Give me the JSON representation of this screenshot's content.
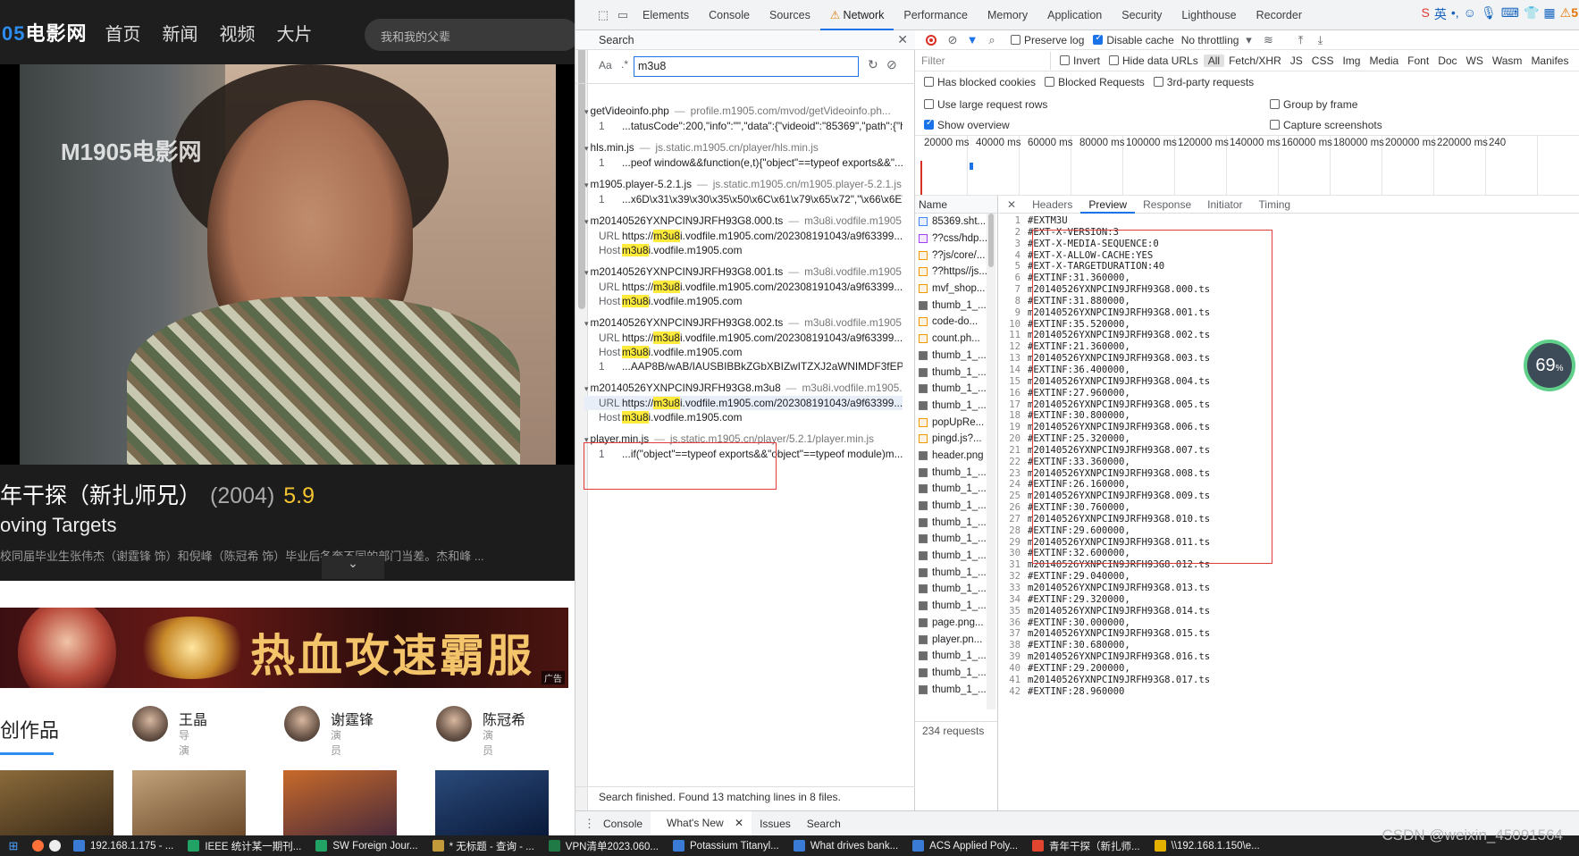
{
  "site": {
    "logo_num": "05",
    "logo_text": "电影网",
    "nav": [
      "首页",
      "新闻",
      "视频",
      "大片"
    ],
    "search_placeholder": "我和我的父辈",
    "watermark": "M1905电影网",
    "film_title": "年干探（新扎师兄）",
    "film_year": "(2004)",
    "film_score": "5.9",
    "film_en": "oving Targets",
    "film_desc": "校同届毕业生张伟杰（谢霆锋 饰）和倪峰（陈冠希 饰）毕业后各奔不同的部门当差。杰和峰 ...",
    "ad_text": "热血攻速霸服",
    "ad_tag": "广告",
    "cast_heading": "创作品",
    "cast": [
      {
        "name": "王晶",
        "role": "导演"
      },
      {
        "name": "谢霆锋",
        "role": "演员"
      },
      {
        "name": "陈冠希",
        "role": "演员"
      }
    ]
  },
  "devtools": {
    "tabs": [
      "Elements",
      "Console",
      "Sources",
      "Network",
      "Performance",
      "Memory",
      "Application",
      "Security",
      "Lighthouse",
      "Recorder"
    ],
    "active_tab": "Network",
    "warning_count": "5",
    "search": {
      "title": "Search",
      "query": "m3u8",
      "status": "Search finished.  Found 13 matching lines in 8 files.",
      "results": [
        {
          "file": "getVideoinfo.php",
          "url": "profile.m1905.com/mvod/getVideoinfo.ph...",
          "lines": [
            {
              "k": "1",
              "text": "...tatusCode\":200,\"info\":\"\",\"data\":{\"videoid\":\"85369\",\"path\":{\"h..."
            }
          ]
        },
        {
          "file": "hls.min.js",
          "url": "js.static.m1905.cn/player/hls.min.js",
          "lines": [
            {
              "k": "1",
              "text": "...peof window&&function(e,t){\"object\"==typeof exports&&\"..."
            }
          ]
        },
        {
          "file": "m1905.player-5.2.1.js",
          "url": "js.static.m1905.cn/m1905.player-5.2.1.js",
          "lines": [
            {
              "k": "1",
              "text": "...x6D\\x31\\x39\\x30\\x35\\x50\\x6C\\x61\\x79\\x65\\x72\",\"\\x66\\x6E\"..."
            }
          ]
        },
        {
          "file": "m20140526YXNPCIN9JRFH93G8.000.ts",
          "url": "m3u8i.vodfile.m1905....",
          "lines": [
            {
              "k": "URL",
              "pre": "https://",
              "hl": "m3u8",
              "text": "i.vodfile.m1905.com/202308191043/a9f63399..."
            },
            {
              "k": "Host",
              "pre": "",
              "hl": "m3u8",
              "text": "i.vodfile.m1905.com"
            }
          ]
        },
        {
          "file": "m20140526YXNPCIN9JRFH93G8.001.ts",
          "url": "m3u8i.vodfile.m1905....",
          "lines": [
            {
              "k": "URL",
              "pre": "https://",
              "hl": "m3u8",
              "text": "i.vodfile.m1905.com/202308191043/a9f63399..."
            },
            {
              "k": "Host",
              "pre": "",
              "hl": "m3u8",
              "text": "i.vodfile.m1905.com"
            }
          ]
        },
        {
          "file": "m20140526YXNPCIN9JRFH93G8.002.ts",
          "url": "m3u8i.vodfile.m1905....",
          "lines": [
            {
              "k": "URL",
              "pre": "https://",
              "hl": "m3u8",
              "text": "i.vodfile.m1905.com/202308191043/a9f63399..."
            },
            {
              "k": "Host",
              "pre": "",
              "hl": "m3u8",
              "text": "i.vodfile.m1905.com"
            },
            {
              "k": "1",
              "text": "...AAP8B/wAB/IAUSBIBBkZGbXBIZwITZXJ2aWNIMDF3fEPK////..."
            }
          ]
        },
        {
          "file": "m20140526YXNPCIN9JRFH93G8.m3u8",
          "url": "m3u8i.vodfile.m1905....",
          "lines": [
            {
              "k": "URL",
              "pre": "https://",
              "hl": "m3u8",
              "text": "i.vodfile.m1905.com/202308191043/a9f63399..."
            },
            {
              "k": "Host",
              "pre": "",
              "hl": "m3u8",
              "text": "i.vodfile.m1905.com"
            }
          ]
        },
        {
          "file": "player.min.js",
          "url": "js.static.m1905.cn/player/5.2.1/player.min.js",
          "lines": [
            {
              "k": "1",
              "text": "...if(\"object\"==typeof exports&&\"object\"==typeof module)m..."
            }
          ]
        }
      ]
    },
    "network": {
      "toolbar": {
        "preserve_log": "Preserve log",
        "disable_cache": "Disable cache",
        "throttling": "No throttling"
      },
      "filter_placeholder": "Filter",
      "invert": "Invert",
      "hide_data_urls": "Hide data URLs",
      "types": [
        "All",
        "Fetch/XHR",
        "JS",
        "CSS",
        "Img",
        "Media",
        "Font",
        "Doc",
        "WS",
        "Wasm",
        "Manifes"
      ],
      "blocked_cookies": "Has blocked cookies",
      "blocked_requests": "Blocked Requests",
      "third_party": "3rd-party requests",
      "large_rows": "Use large request rows",
      "group_by_frame": "Group by frame",
      "show_overview": "Show overview",
      "capture_screenshots": "Capture screenshots",
      "timeline": [
        "20000 ms",
        "40000 ms",
        "60000 ms",
        "80000 ms",
        "100000 ms",
        "120000 ms",
        "140000 ms",
        "160000 ms",
        "180000 ms",
        "200000 ms",
        "220000 ms",
        "240"
      ],
      "name_header": "Name",
      "requests": [
        {
          "name": "85369.sht...",
          "type": "doc"
        },
        {
          "name": "??css/hdp...",
          "type": "css"
        },
        {
          "name": "??js/core/...",
          "type": "js"
        },
        {
          "name": "??https//js...",
          "type": "js"
        },
        {
          "name": "mvf_shop...",
          "type": "js"
        },
        {
          "name": "thumb_1_...",
          "type": "img"
        },
        {
          "name": "code-do...",
          "type": "js"
        },
        {
          "name": "count.ph...",
          "type": "js"
        },
        {
          "name": "thumb_1_...",
          "type": "img"
        },
        {
          "name": "thumb_1_...",
          "type": "img"
        },
        {
          "name": "thumb_1_...",
          "type": "img"
        },
        {
          "name": "thumb_1_...",
          "type": "img"
        },
        {
          "name": "popUpRe...",
          "type": "js"
        },
        {
          "name": "pingd.js?...",
          "type": "js"
        },
        {
          "name": "header.png",
          "type": "img"
        },
        {
          "name": "thumb_1_...",
          "type": "img"
        },
        {
          "name": "thumb_1_...",
          "type": "img"
        },
        {
          "name": "thumb_1_...",
          "type": "img"
        },
        {
          "name": "thumb_1_...",
          "type": "img"
        },
        {
          "name": "thumb_1_...",
          "type": "img"
        },
        {
          "name": "thumb_1_...",
          "type": "img"
        },
        {
          "name": "thumb_1_...",
          "type": "img"
        },
        {
          "name": "thumb_1_...",
          "type": "img"
        },
        {
          "name": "thumb_1_...",
          "type": "img"
        },
        {
          "name": "page.png...",
          "type": "img"
        },
        {
          "name": "player.pn...",
          "type": "img"
        },
        {
          "name": "thumb_1_...",
          "type": "img"
        },
        {
          "name": "thumb_1_...",
          "type": "img"
        },
        {
          "name": "thumb_1_...",
          "type": "img"
        }
      ],
      "request_count": "234 requests",
      "detail_tabs": [
        "Headers",
        "Preview",
        "Response",
        "Initiator",
        "Timing"
      ],
      "active_detail_tab": "Preview",
      "preview_lines": [
        "#EXTM3U",
        "#EXT-X-VERSION:3",
        "#EXT-X-MEDIA-SEQUENCE:0",
        "#EXT-X-ALLOW-CACHE:YES",
        "#EXT-X-TARGETDURATION:40",
        "#EXTINF:31.360000,",
        "m20140526YXNPCIN9JRFH93G8.000.ts",
        "#EXTINF:31.880000,",
        "m20140526YXNPCIN9JRFH93G8.001.ts",
        "#EXTINF:35.520000,",
        "m20140526YXNPCIN9JRFH93G8.002.ts",
        "#EXTINF:21.360000,",
        "m20140526YXNPCIN9JRFH93G8.003.ts",
        "#EXTINF:36.400000,",
        "m20140526YXNPCIN9JRFH93G8.004.ts",
        "#EXTINF:27.960000,",
        "m20140526YXNPCIN9JRFH93G8.005.ts",
        "#EXTINF:30.800000,",
        "m20140526YXNPCIN9JRFH93G8.006.ts",
        "#EXTINF:25.320000,",
        "m20140526YXNPCIN9JRFH93G8.007.ts",
        "#EXTINF:33.360000,",
        "m20140526YXNPCIN9JRFH93G8.008.ts",
        "#EXTINF:26.160000,",
        "m20140526YXNPCIN9JRFH93G8.009.ts",
        "#EXTINF:30.760000,",
        "m20140526YXNPCIN9JRFH93G8.010.ts",
        "#EXTINF:29.600000,",
        "m20140526YXNPCIN9JRFH93G8.011.ts",
        "#EXTINF:32.600000,",
        "m20140526YXNPCIN9JRFH93G8.012.ts",
        "#EXTINF:29.040000,",
        "m20140526YXNPCIN9JRFH93G8.013.ts",
        "#EXTINF:29.320000,",
        "m20140526YXNPCIN9JRFH93G8.014.ts",
        "#EXTINF:30.000000,",
        "m20140526YXNPCIN9JRFH93G8.015.ts",
        "#EXTINF:30.680000,",
        "m20140526YXNPCIN9JRFH93G8.016.ts",
        "#EXTINF:29.200000,",
        "m20140526YXNPCIN9JRFH93G8.017.ts",
        "#EXTINF:28.960000"
      ]
    },
    "drawer_tabs": [
      "Console",
      "What's New",
      "Issues",
      "Search"
    ],
    "active_drawer_tab": "What's New"
  },
  "gauge": {
    "value": "69",
    "unit": "%"
  },
  "taskbar": {
    "items": [
      {
        "label": "192.168.1.175 - ...",
        "color": "#3a7bd5"
      },
      {
        "label": "IEEE 统计某一期刊...",
        "color": "#21a366"
      },
      {
        "label": "SW Foreign Jour...",
        "color": "#21a366"
      },
      {
        "label": "* 无标题 - 查询 - ...",
        "color": "#c29a3a"
      },
      {
        "label": "VPN清单2023.060...",
        "color": "#1f7a45"
      },
      {
        "label": "Potassium Titanyl...",
        "color": "#3a7bd5"
      },
      {
        "label": "What drives bank...",
        "color": "#3a7bd5"
      },
      {
        "label": "ACS Applied Poly...",
        "color": "#3a7bd5"
      },
      {
        "label": "青年干探（新扎师...",
        "color": "#e0452f"
      },
      {
        "label": "\\\\192.168.1.150\\e...",
        "color": "#e5b100"
      }
    ],
    "watermark": "CSDN @weixin_45091564"
  }
}
